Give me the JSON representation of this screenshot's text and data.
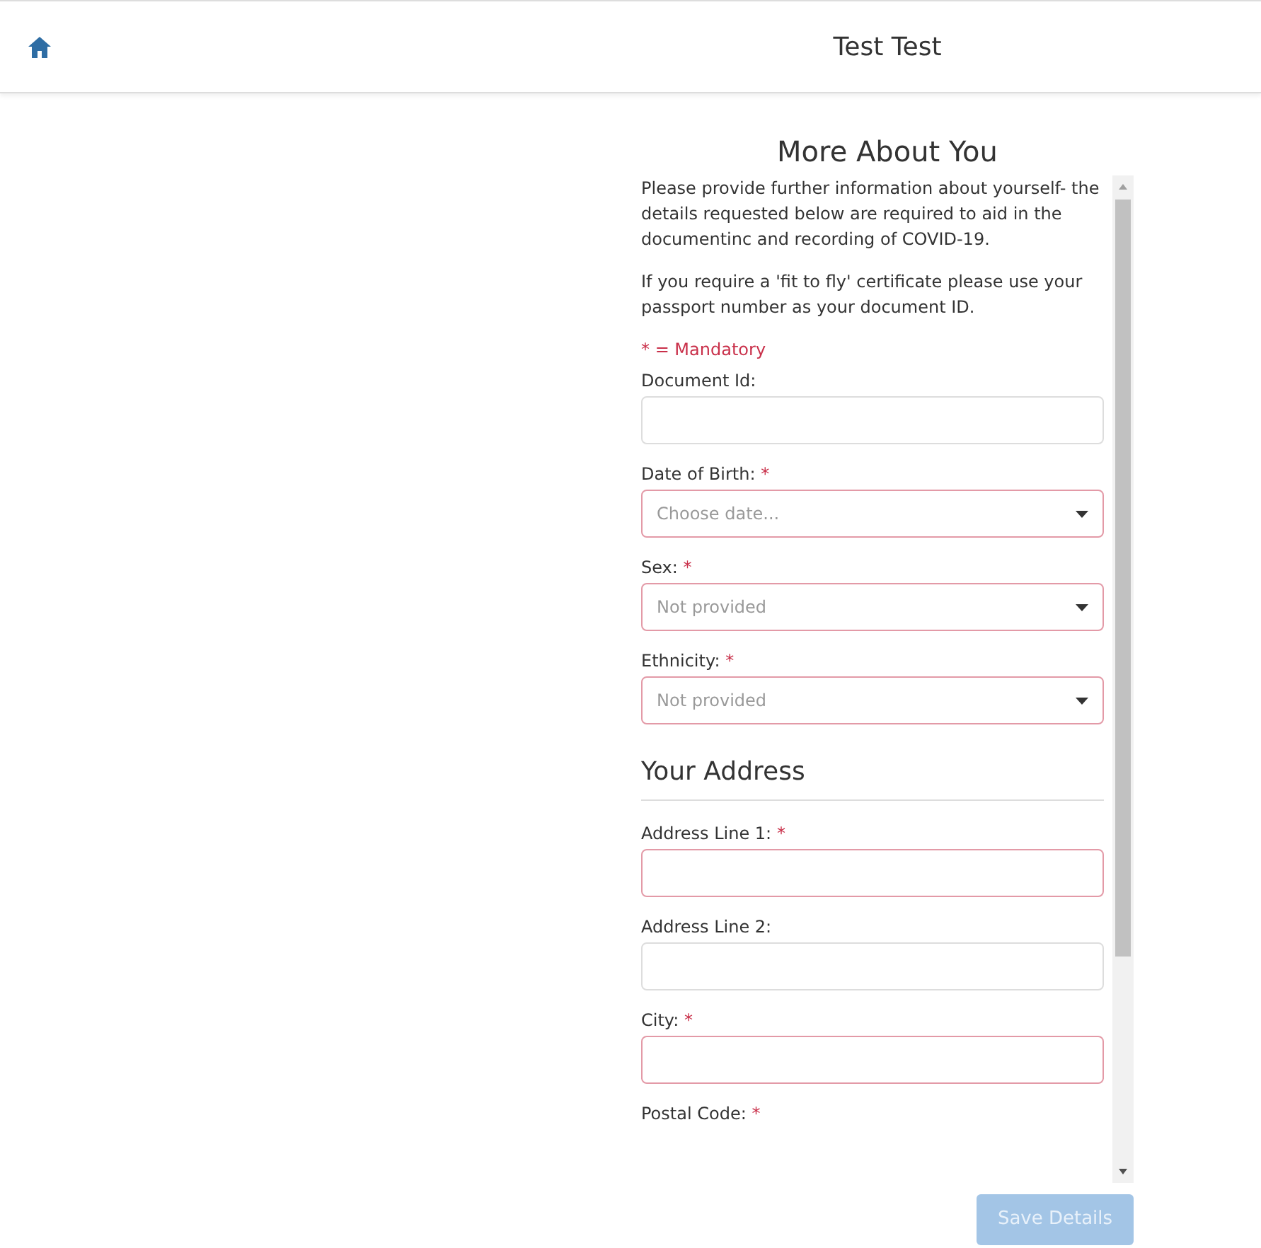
{
  "header": {
    "title": "Test Test"
  },
  "section_title": "More About You",
  "intro": [
    "Please provide further information about yourself- the details requested below are required to aid in the documentinc and recording of COVID-19.",
    "If you require a 'fit to fly' certificate please use your passport number as your document ID."
  ],
  "mandatory_note": "* = Mandatory",
  "fields": [
    {
      "kind": "text",
      "label": "Document Id:",
      "required": false
    },
    {
      "kind": "select",
      "label": "Date of Birth:",
      "required": true,
      "required_mark": "*",
      "placeholder": "Choose date..."
    },
    {
      "kind": "select",
      "label": "Sex:",
      "required": true,
      "required_mark": "*",
      "placeholder": "Not provided"
    },
    {
      "kind": "select",
      "label": "Ethnicity:",
      "required": true,
      "required_mark": "*",
      "placeholder": "Not provided"
    },
    {
      "kind": "heading",
      "label": "Your Address"
    },
    {
      "kind": "text",
      "label": "Address Line 1:",
      "required": true,
      "required_mark": "*"
    },
    {
      "kind": "text",
      "label": "Address Line 2:",
      "required": false
    },
    {
      "kind": "text",
      "label": "City:",
      "required": true,
      "required_mark": "*"
    },
    {
      "kind": "label",
      "label": "Postal Code:",
      "required": true,
      "required_mark": "*"
    }
  ],
  "save_button": {
    "label": "Save Details",
    "disabled": true
  }
}
